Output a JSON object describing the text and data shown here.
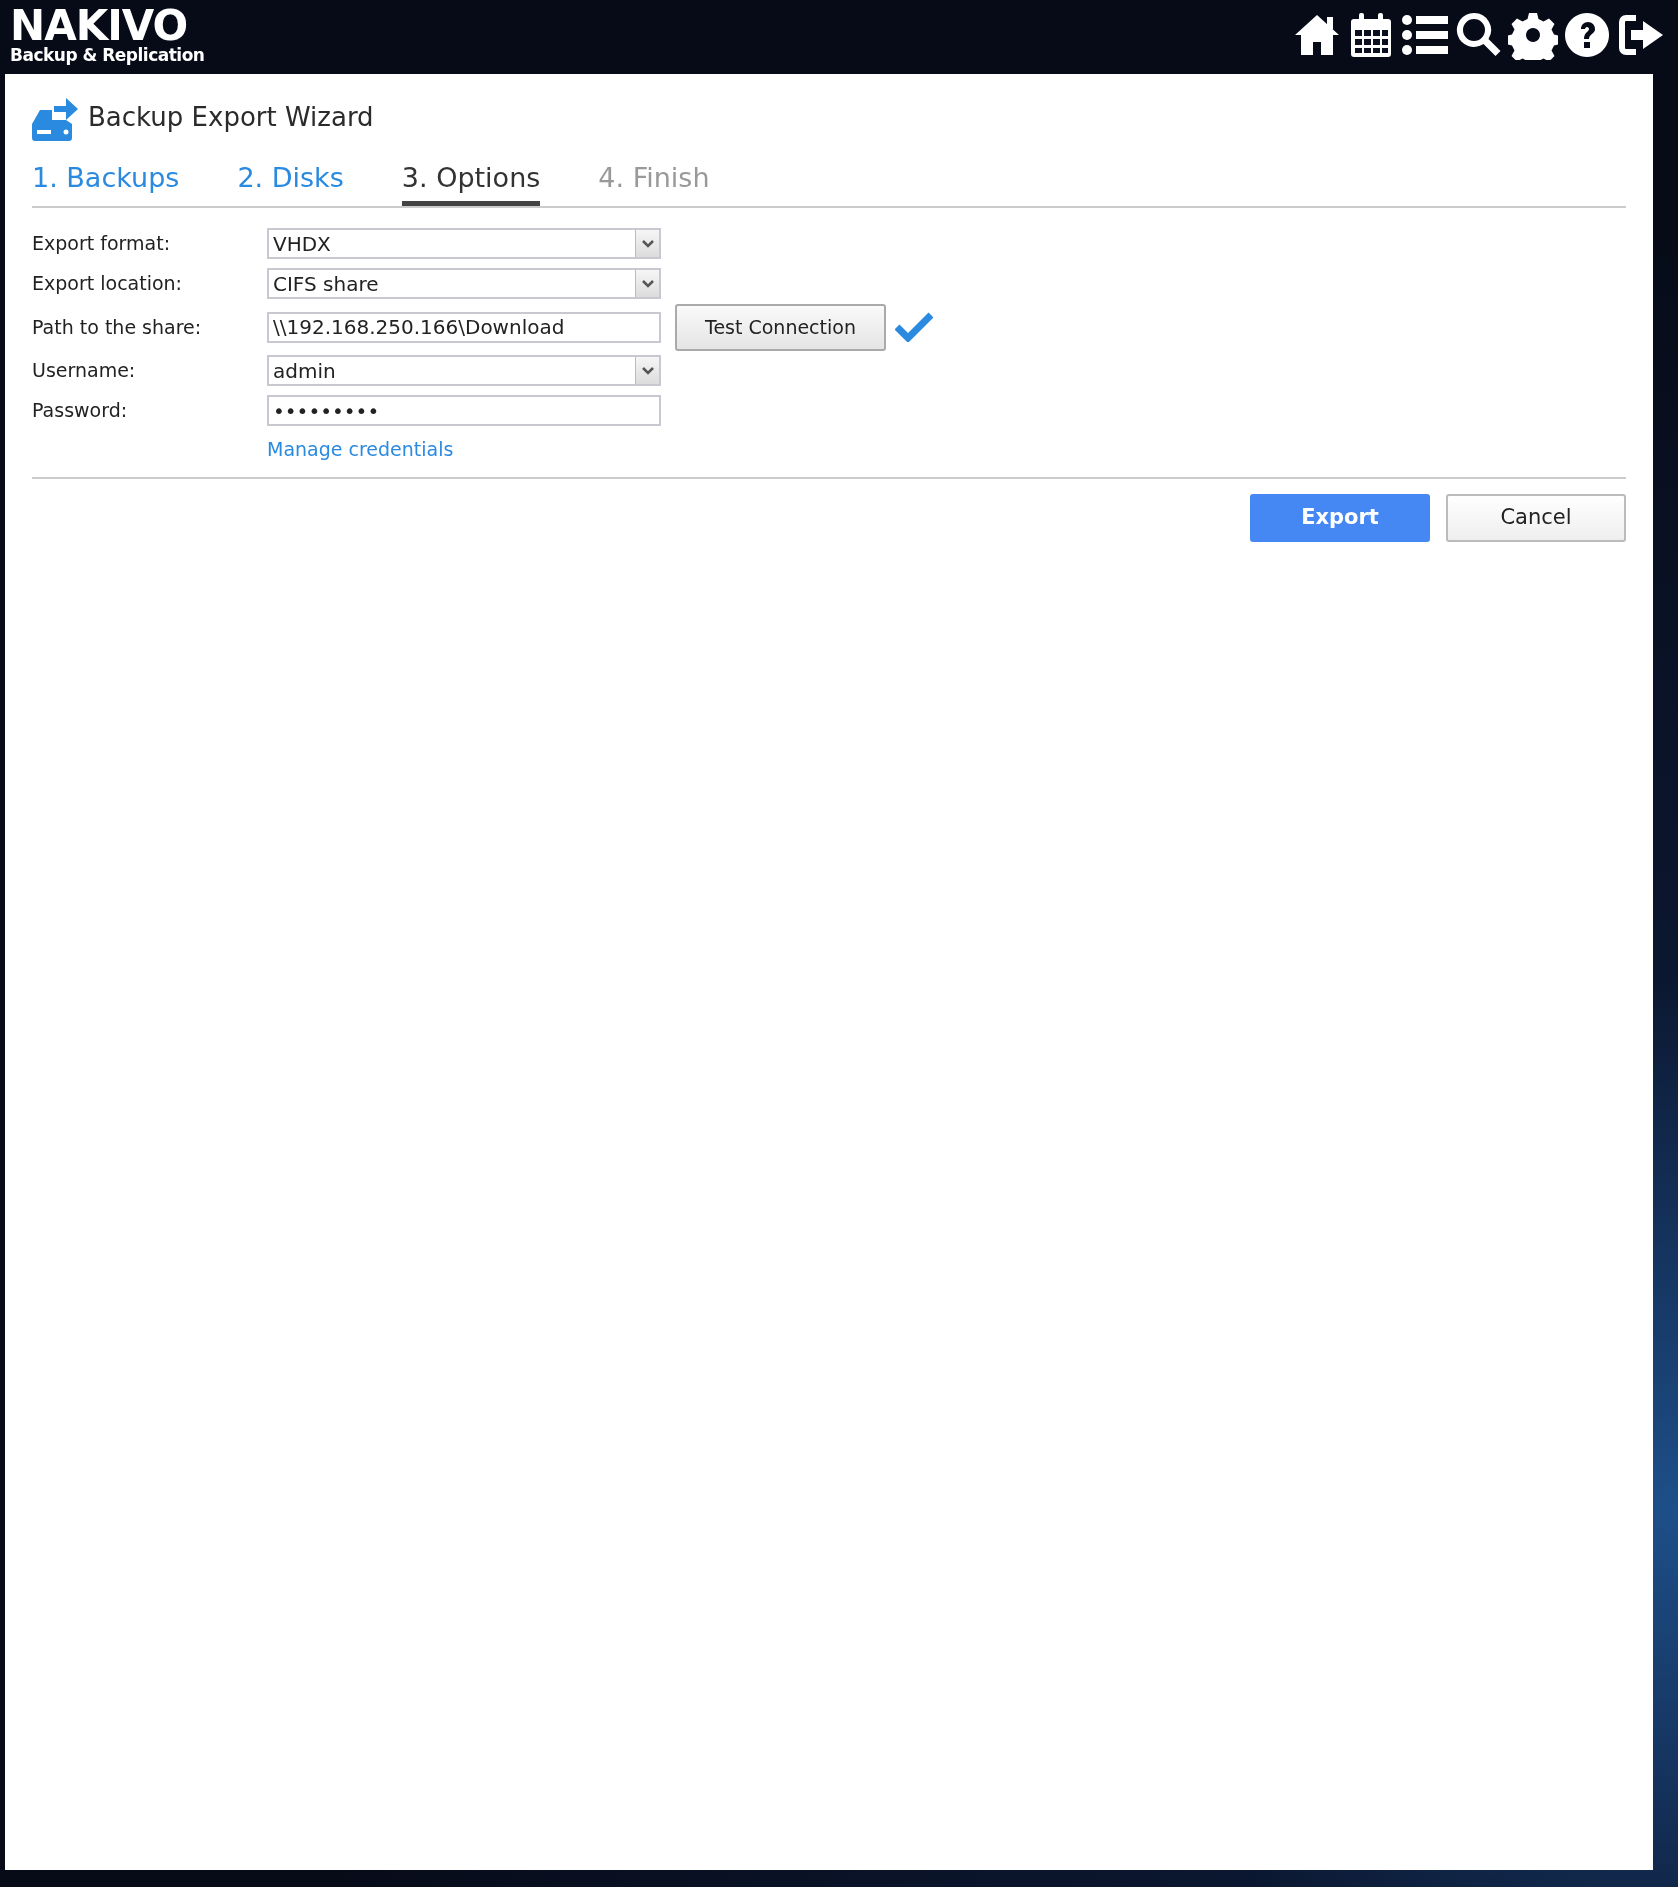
{
  "header": {
    "logo": {
      "name": "NAKIVO",
      "tagline": "Backup & Replication"
    }
  },
  "wizard": {
    "title": "Backup Export Wizard",
    "steps": [
      {
        "label": "1. Backups",
        "selected": false,
        "disabled": false
      },
      {
        "label": "2. Disks",
        "selected": false,
        "disabled": false
      },
      {
        "label": "3. Options",
        "selected": true,
        "disabled": false
      },
      {
        "label": "4. Finish",
        "selected": false,
        "disabled": true
      }
    ],
    "fields": [
      {
        "label": "Export format:",
        "kind": "select",
        "value": "VHDX"
      },
      {
        "label": "Export location:",
        "kind": "select",
        "value": "CIFS share"
      },
      {
        "label": "Path to the share:",
        "kind": "text",
        "value": "\\\\192.168.250.166\\Download",
        "action": "Test Connection",
        "verified": true
      },
      {
        "label": "Username:",
        "kind": "select",
        "value": "admin"
      },
      {
        "label": "Password:",
        "kind": "password",
        "value": "•••••••••"
      }
    ],
    "link": "Manage credentials",
    "buttons": [
      {
        "label": "Export",
        "kind": "primary"
      },
      {
        "label": "Cancel",
        "kind": "secondary"
      }
    ]
  }
}
